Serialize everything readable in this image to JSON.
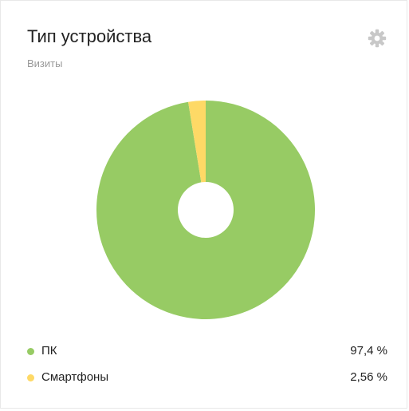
{
  "widget": {
    "title": "Тип устройства",
    "subtitle": "Визиты",
    "settings_icon": "gear-icon"
  },
  "colors": {
    "pc": "#97cb64",
    "smartphones": "#fed966",
    "gear": "#c8c8c8",
    "hole": "#ffffff"
  },
  "chart_data": {
    "type": "pie",
    "donut": true,
    "title": "Тип устройства",
    "subtitle": "Визиты",
    "slices": [
      {
        "label": "ПК",
        "value": 97.4,
        "display": "97,4 %",
        "color": "#97cb64"
      },
      {
        "label": "Смартфоны",
        "value": 2.56,
        "display": "2,56 %",
        "color": "#fed966"
      }
    ],
    "legend": "bottom"
  }
}
